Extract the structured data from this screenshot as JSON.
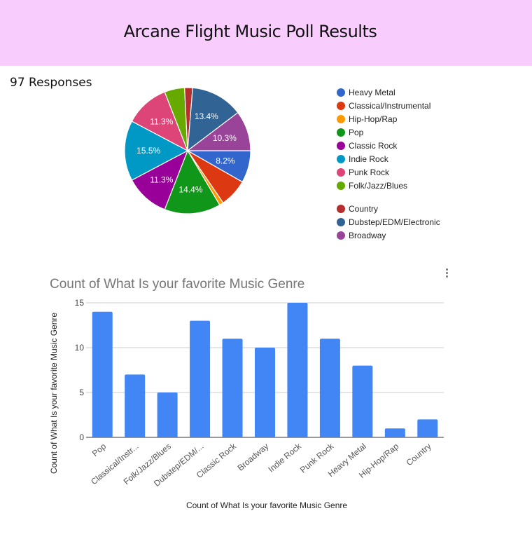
{
  "header": {
    "title": "Arcane Flight Music Poll Results"
  },
  "responses_label": "97 Responses",
  "chart_data": [
    {
      "type": "pie",
      "title": "",
      "total": 97,
      "legend_position": "right",
      "slices": [
        {
          "label": "Heavy Metal",
          "value": 8,
          "pct_label": "8.2%",
          "color": "#3366cc"
        },
        {
          "label": "Classical/Instrumental",
          "value": 7,
          "pct_label": "",
          "color": "#dc3912"
        },
        {
          "label": "Hip-Hop/Rap",
          "value": 1,
          "pct_label": "",
          "color": "#ff9900"
        },
        {
          "label": "Pop",
          "value": 14,
          "pct_label": "14.4%",
          "color": "#109618"
        },
        {
          "label": "Classic Rock",
          "value": 11,
          "pct_label": "11.3%",
          "color": "#990099"
        },
        {
          "label": "Indie Rock",
          "value": 15,
          "pct_label": "15.5%",
          "color": "#0099c6"
        },
        {
          "label": "Punk Rock",
          "value": 11,
          "pct_label": "11.3%",
          "color": "#dd4477"
        },
        {
          "label": "Folk/Jazz/Blues",
          "value": 5,
          "pct_label": "",
          "color": "#66aa00"
        },
        {
          "label": "Country",
          "value": 2,
          "pct_label": "",
          "color": "#b82e2e"
        },
        {
          "label": "Dubstep/EDM/Electronic",
          "value": 13,
          "pct_label": "13.4%",
          "color": "#316395"
        },
        {
          "label": "Broadway",
          "value": 10,
          "pct_label": "10.3%",
          "color": "#994499"
        }
      ]
    },
    {
      "type": "bar",
      "title": "Count of What Is your favorite Music Genre",
      "xlabel": "Count of What Is your favorite Music Genre",
      "ylabel": "Count of What Is your favorite Music Genre",
      "categories": [
        "Pop",
        "Classical/Instr...",
        "Folk/Jazz/Blues",
        "Dubstep/EDM/...",
        "Classic Rock",
        "Broadway",
        "Indie Rock",
        "Punk Rock",
        "Heavy Metal",
        "Hip-Hop/Rap",
        "Country"
      ],
      "values": [
        14,
        7,
        5,
        13,
        11,
        10,
        15,
        11,
        8,
        1,
        2
      ],
      "ylim": [
        0,
        15
      ],
      "yticks": [
        "0",
        "5",
        "10",
        "15"
      ],
      "grid": true,
      "bar_color": "#4285f4"
    }
  ],
  "menu": {
    "icon": "more-vert-icon"
  }
}
